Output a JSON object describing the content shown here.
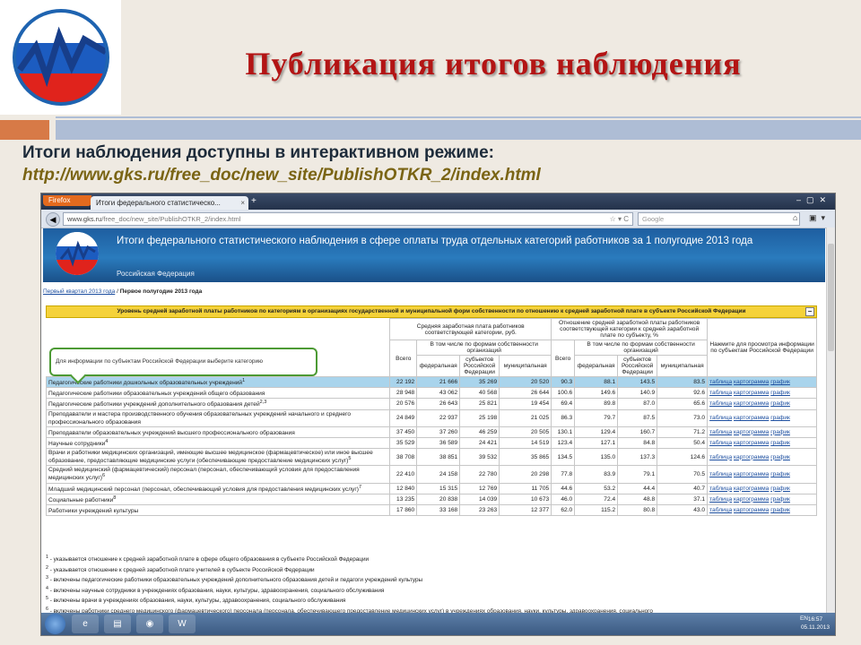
{
  "slide": {
    "title": "Публикация итогов наблюдения",
    "subtitle": "Итоги наблюдения доступны в интерактивном режиме:",
    "url": "http://www.gks.ru/free_doc/new_site/PublishOTKR_2/index.html"
  },
  "browser": {
    "app_button": "Firefox",
    "tab_title": "Итоги федерального статистическо...",
    "tab_close": "×",
    "new_tab": "+",
    "url_domain": "www.gks.ru",
    "url_path": "/free_doc/new_site/PublishOTKR_2/index.html",
    "search_placeholder": "Google"
  },
  "site": {
    "banner_title": "Итоги федерального статистического наблюдения в сфере оплаты труда отдельных категорий работников за 1 полугодие 2013 года",
    "banner_subtitle": "Российская Федерация",
    "breadcrumb_link": "Первый квартал 2013 года",
    "breadcrumb_sep": " / ",
    "breadcrumb_current": "Первое полугодие 2013 года",
    "section_title": "Уровень средней заработной платы работников по категориям в организациях государственной и муниципальной форм собственности по отношению к средней заработной плате в субъекте Российской Федерации",
    "collapse": "−",
    "callout": "Для информации по субъектам Российской Федерации выберите категорию"
  },
  "table": {
    "h_salary": "Средняя заработная плата работников соответствующей категории, руб.",
    "h_ratio": "Отношение средней заработной платы работников соответствующей категории к средней заработной плате по субъекту, %",
    "h_action": "Нажмите для просмотра информации по субъектам Российской Федерации",
    "h_total": "Всего",
    "h_incl": "В том числе по формам собственности организаций",
    "h_fed": "федеральная",
    "h_subj": "субъектов Российской Федерации",
    "h_mun": "муниципальная",
    "links": {
      "table": "таблица",
      "map": "картограмма",
      "graph": "график"
    },
    "rows": [
      {
        "name": "Педагогические работники дошкольных образовательных учреждений",
        "sup": "1",
        "v": [
          "22 192",
          "21 666",
          "35 269",
          "20 520",
          "90.3",
          "88.1",
          "143.5",
          "83.5"
        ]
      },
      {
        "name": "Педагогические работники образовательных учреждений общего образования",
        "sup": "",
        "v": [
          "28 948",
          "43 062",
          "40 568",
          "26 644",
          "100.6",
          "149.6",
          "140.9",
          "92.6"
        ]
      },
      {
        "name": "Педагогические работники учреждений дополнительного образования детей",
        "sup": "2,3",
        "v": [
          "20 576",
          "26 643",
          "25 821",
          "19 454",
          "69.4",
          "89.8",
          "87.0",
          "65.6"
        ]
      },
      {
        "name": "Преподаватели и мастера производственного обучения образовательных учреждений начального и среднего профессионального образования",
        "sup": "",
        "v": [
          "24 849",
          "22 937",
          "25 198",
          "21 025",
          "86.3",
          "79.7",
          "87.5",
          "73.0"
        ]
      },
      {
        "name": "Преподаватели образовательных учреждений высшего профессионального образования",
        "sup": "",
        "v": [
          "37 450",
          "37 260",
          "46 259",
          "20 505",
          "130.1",
          "129.4",
          "160.7",
          "71.2"
        ]
      },
      {
        "name": "Научные сотрудники",
        "sup": "4",
        "v": [
          "35 529",
          "36 589",
          "24 421",
          "14 519",
          "123.4",
          "127.1",
          "84.8",
          "50.4"
        ]
      },
      {
        "name": "Врачи и работники медицинских организаций, имеющие высшее медицинское (фармацевтическое) или иное высшее образование, предоставляющие медицинские услуги (обеспечивающие предоставление медицинских услуг)",
        "sup": "5",
        "v": [
          "38 708",
          "38 851",
          "39 532",
          "35 865",
          "134.5",
          "135.0",
          "137.3",
          "124.6"
        ]
      },
      {
        "name": "Средний медицинский (фармацевтический) персонал (персонал, обеспечивающий условия для предоставления медицинских услуг)",
        "sup": "6",
        "v": [
          "22 410",
          "24 158",
          "22 780",
          "20 298",
          "77.8",
          "83.9",
          "79.1",
          "70.5"
        ]
      },
      {
        "name": "Младший медицинский персонал (персонал, обеспечивающий условия для предоставления медицинских услуг)",
        "sup": "7",
        "v": [
          "12 840",
          "15 315",
          "12 769",
          "11 705",
          "44.6",
          "53.2",
          "44.4",
          "40.7"
        ]
      },
      {
        "name": "Социальные работники",
        "sup": "8",
        "v": [
          "13 235",
          "20 838",
          "14 039",
          "10 673",
          "46.0",
          "72.4",
          "48.8",
          "37.1"
        ]
      },
      {
        "name": "Работники учреждений культуры",
        "sup": "",
        "v": [
          "17 860",
          "33 168",
          "23 263",
          "12 377",
          "62.0",
          "115.2",
          "80.8",
          "43.0"
        ]
      }
    ]
  },
  "notes": [
    {
      "n": "1",
      "t": " - указывается отношение к средней заработной плате в сфере общего образования в субъекте Российской Федерации"
    },
    {
      "n": "2",
      "t": " - указывается отношение к средней заработной плате учителей в субъекте Российской Федерации"
    },
    {
      "n": "3",
      "t": " - включены педагогические работники образовательных учреждений дополнительного образования детей и педагоги учреждений культуры"
    },
    {
      "n": "4",
      "t": " - включены научные сотрудники в учреждениях образования, науки, культуры, здравоохранения, социального обслуживания"
    },
    {
      "n": "5",
      "t": " - включены врачи в учреждениях образования, науки, культуры, здравоохранения, социального обслуживания"
    },
    {
      "n": "6",
      "t": " - включены работники среднего медицинского (фармацевтического) персонала (персонала, обеспечивающего предоставление медицинских услуг) в учреждениях образования, науки, культуры, здравоохранения, социального"
    }
  ],
  "taskbar": {
    "lang": "EN",
    "time": "16:57",
    "date": "05.11.2013",
    "apps": [
      "e",
      "▤",
      "◉",
      "W"
    ]
  },
  "colors": {
    "title_red": "#b31414",
    "url_gold": "#7a6414",
    "highlight_row": "#a9d4ec",
    "section_yellow": "#f5d23a",
    "callout_green": "#4c9a34"
  }
}
